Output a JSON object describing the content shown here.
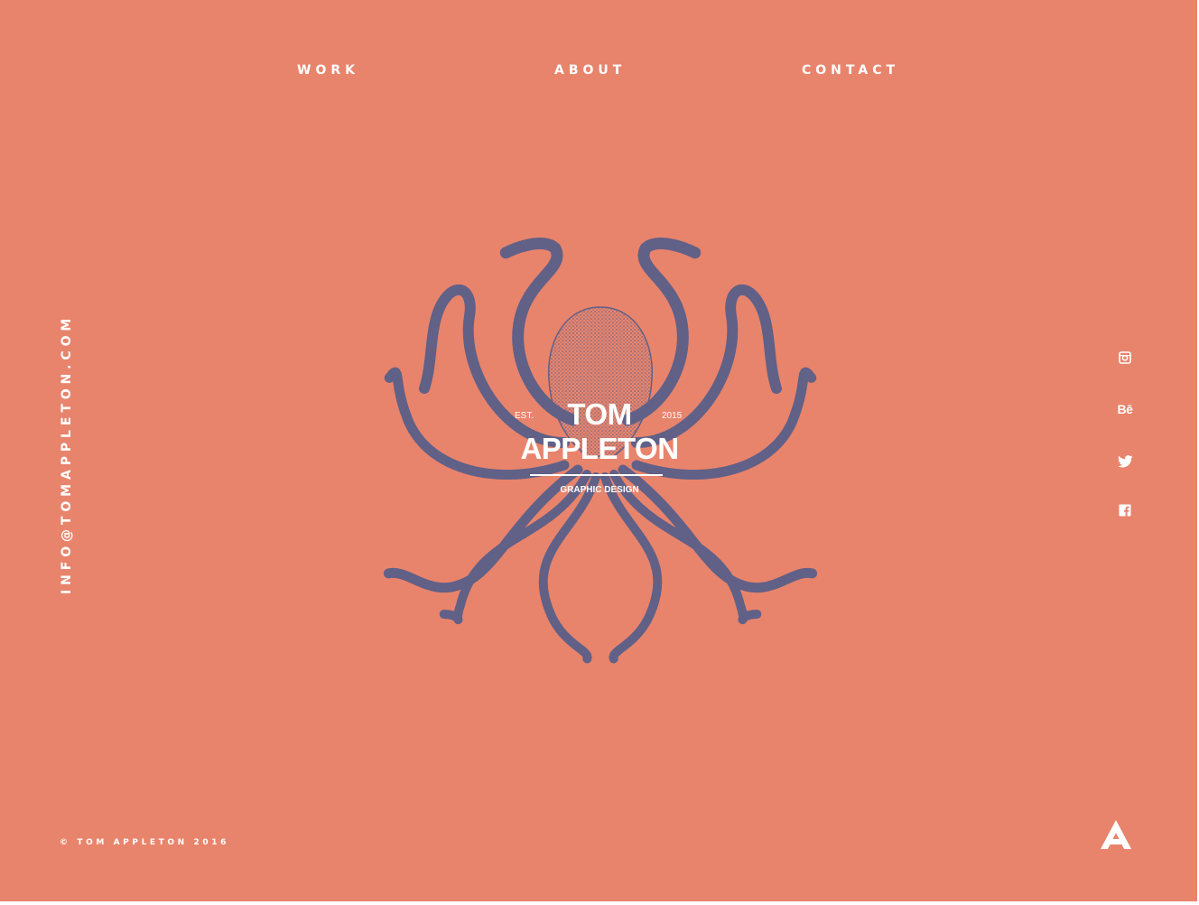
{
  "nav": {
    "items": [
      {
        "label": "WORK"
      },
      {
        "label": "ABOUT"
      },
      {
        "label": "CONTACT"
      }
    ]
  },
  "sidebar": {
    "email": "INFO@TOMAPPLETON.COM"
  },
  "hero": {
    "illustration": "octopus-illustration",
    "est_label": "EST.",
    "year": "2015",
    "name_line1": "TOM",
    "name_line2": "APPLETON",
    "tagline": "GRAPHIC DESIGN"
  },
  "social": {
    "items": [
      {
        "icon": "instagram-icon"
      },
      {
        "icon": "behance-icon",
        "text": "Bē"
      },
      {
        "icon": "twitter-icon"
      },
      {
        "icon": "facebook-icon"
      }
    ]
  },
  "footer": {
    "copyright": "© TOM APPLETON 2016",
    "logo": "a-logo-icon"
  },
  "colors": {
    "background": "#e8846c",
    "text": "#ffffff",
    "illustration": "#4a5a8c"
  }
}
